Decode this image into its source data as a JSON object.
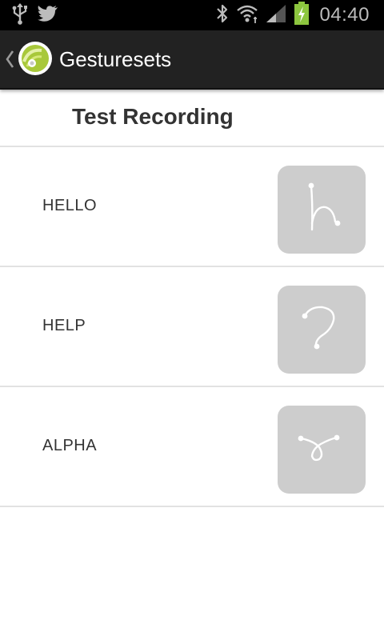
{
  "status_bar": {
    "time": "04:40",
    "left_icons": [
      "usb-icon",
      "twitter-bird-icon"
    ],
    "right_icons": [
      "bluetooth-icon",
      "wifi-icon",
      "signal-icon",
      "battery-charging-icon"
    ],
    "battery_color": "#8dc63f"
  },
  "action_bar": {
    "title": "Gesturesets",
    "app_icon": "gesture-app-logo-icon",
    "up_icon": "chevron-left-icon"
  },
  "list": {
    "header": "Test Recording",
    "gestures": [
      {
        "name": "HELLO",
        "icon": "gesture-h-icon"
      },
      {
        "name": "HELP",
        "icon": "gesture-question-mark-icon"
      },
      {
        "name": "ALPHA",
        "icon": "gesture-alpha-loop-icon"
      }
    ]
  },
  "colors": {
    "status_bar_bg": "#000000",
    "action_bar_bg": "#222222",
    "thumb_bg": "#cdcdcd",
    "divider": "#e2e2e2"
  }
}
